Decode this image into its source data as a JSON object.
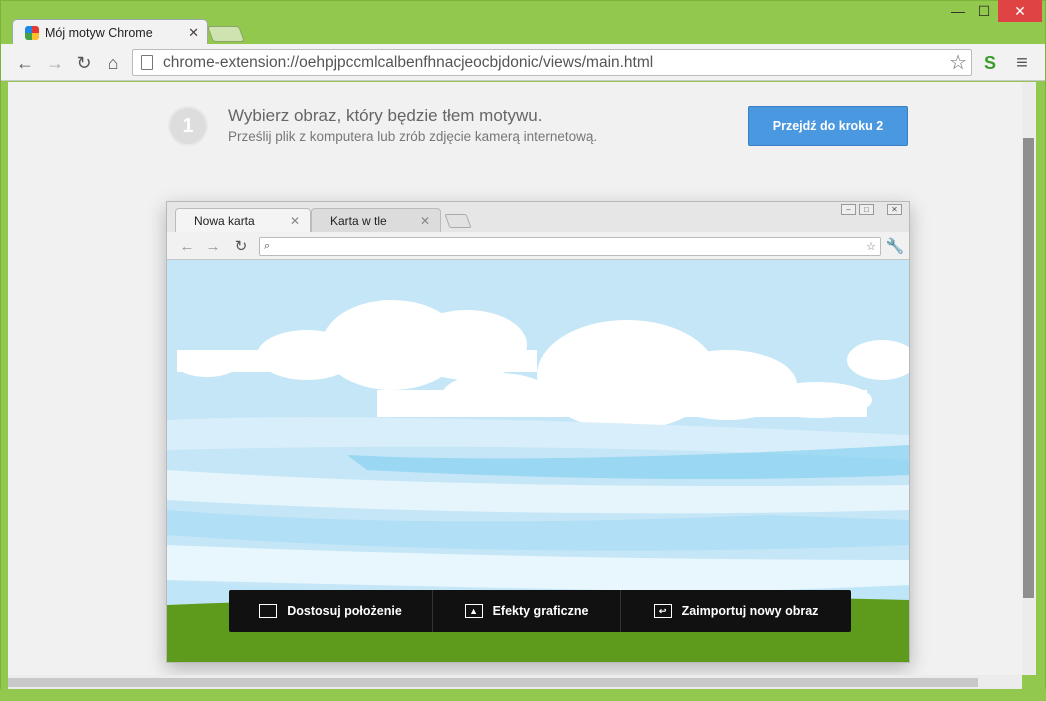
{
  "window": {
    "tab_title": "Mój motyw Chrome",
    "minimize": "—",
    "maximize": "☐",
    "close": "✕"
  },
  "toolbar": {
    "url": "chrome-extension://oehpjpccmlcalbenfhnacjeocbjdonic/views/main.html"
  },
  "step": {
    "number": "1",
    "title": "Wybierz obraz, który będzie tłem motywu.",
    "subtitle": "Prześlij plik z komputera lub zrób zdjęcie kamerą internetową.",
    "next_label": "Przejdź do kroku 2"
  },
  "preview": {
    "tabs": [
      {
        "label": "Nowa karta"
      },
      {
        "label": "Karta w tle"
      }
    ],
    "actions": [
      {
        "label": "Dostosuj położenie",
        "icon": "crop-icon"
      },
      {
        "label": "Efekty graficzne",
        "icon": "image-effects-icon"
      },
      {
        "label": "Zaimportuj nowy obraz",
        "icon": "import-icon"
      }
    ]
  },
  "colors": {
    "frame": "#93c84e",
    "accent_button": "#4a98e0",
    "sky": "#c5e6f7",
    "grass": "#5e9a1c"
  }
}
